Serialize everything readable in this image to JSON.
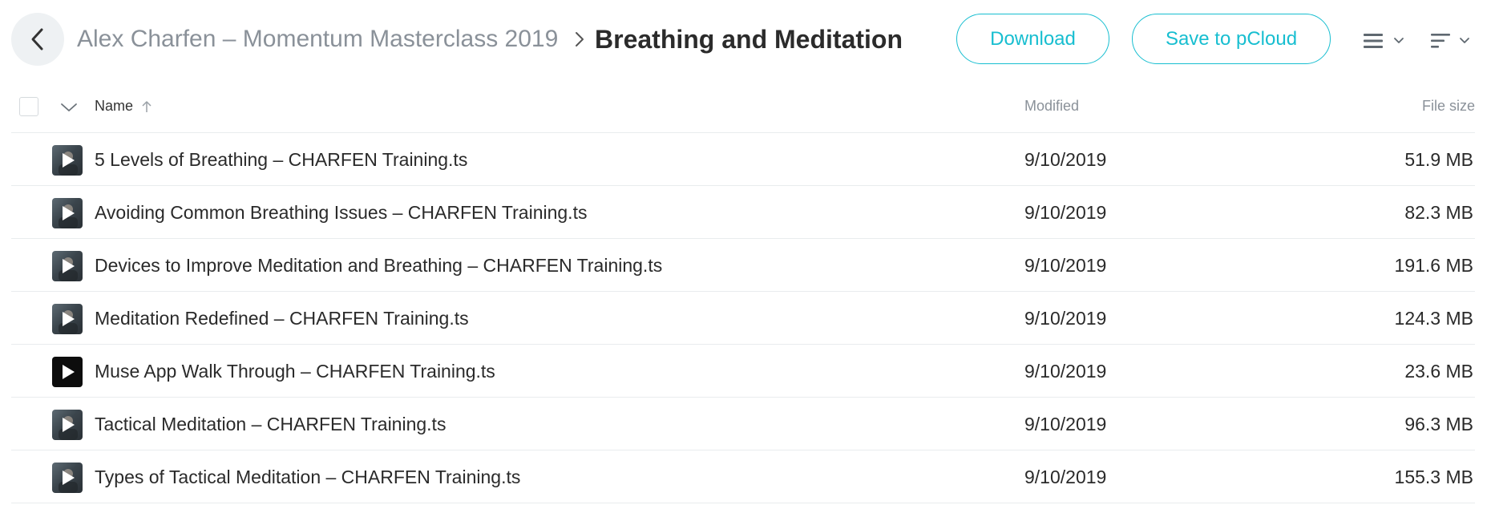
{
  "header": {
    "breadcrumb_parent": "Alex Charfen – Momentum Masterclass 2019",
    "breadcrumb_current": "Breathing and Meditation",
    "download_label": "Download",
    "save_label": "Save to pCloud"
  },
  "colors": {
    "accent": "#17bed0",
    "muted_text": "#8a9199",
    "divider": "#e9ecee"
  },
  "table": {
    "columns": {
      "name": "Name",
      "modified": "Modified",
      "size": "File size"
    },
    "sort": {
      "column": "name",
      "direction": "ascending"
    },
    "rows": [
      {
        "name": "5 Levels of Breathing – CHARFEN Training.ts",
        "modified": "9/10/2019",
        "size": "51.9 MB",
        "thumb": "photo"
      },
      {
        "name": "Avoiding Common Breathing Issues – CHARFEN Training.ts",
        "modified": "9/10/2019",
        "size": "82.3 MB",
        "thumb": "photo"
      },
      {
        "name": "Devices to Improve Meditation and Breathing – CHARFEN Training.ts",
        "modified": "9/10/2019",
        "size": "191.6 MB",
        "thumb": "photo"
      },
      {
        "name": "Meditation Redefined – CHARFEN Training.ts",
        "modified": "9/10/2019",
        "size": "124.3 MB",
        "thumb": "photo"
      },
      {
        "name": "Muse App Walk Through – CHARFEN Training.ts",
        "modified": "9/10/2019",
        "size": "23.6 MB",
        "thumb": "dark"
      },
      {
        "name": "Tactical Meditation – CHARFEN Training.ts",
        "modified": "9/10/2019",
        "size": "96.3 MB",
        "thumb": "photo"
      },
      {
        "name": "Types of Tactical Meditation – CHARFEN Training.ts",
        "modified": "9/10/2019",
        "size": "155.3 MB",
        "thumb": "photo"
      }
    ]
  },
  "icons": {
    "back": "chevron-left-icon",
    "breadcrumb_separator": "chevron-right-icon",
    "view": "list-view-icon",
    "sort": "sort-lines-icon",
    "select_menu": "chevron-down-icon",
    "sort_direction": "arrow-up-icon",
    "file": "video-play-icon"
  }
}
